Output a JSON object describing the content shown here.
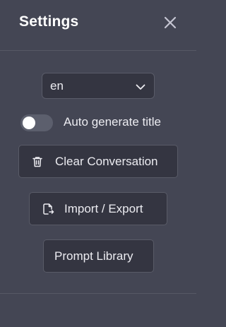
{
  "header": {
    "title": "Settings"
  },
  "language": {
    "selected": "en"
  },
  "auto_title": {
    "label": "Auto generate title",
    "enabled": false
  },
  "actions": {
    "clear_label": "Clear Conversation",
    "import_export_label": "Import / Export",
    "prompt_library_label": "Prompt Library"
  },
  "icons": {
    "close": "close-icon",
    "chevron": "chevron-down-icon",
    "trash": "trash-icon",
    "file_export": "file-export-icon"
  },
  "colors": {
    "panel_bg": "#444654",
    "control_bg": "#343541",
    "border": "#595b67",
    "text": "#ececf1"
  }
}
